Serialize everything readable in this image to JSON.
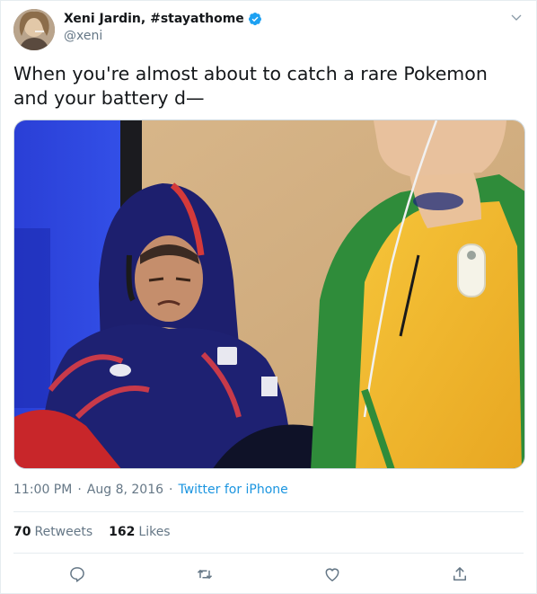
{
  "author": {
    "display_name": "Xeni Jardin, #stayathome",
    "handle": "@xeni",
    "verified": true
  },
  "tweet": {
    "text": "When you're almost about to catch a rare Pokemon\nand your battery d—"
  },
  "meta": {
    "time": "11:00 PM",
    "separator": "·",
    "date": "Aug 8, 2016",
    "source": "Twitter for iPhone"
  },
  "stats": {
    "retweets_count": "70",
    "retweets_label": "Retweets",
    "likes_count": "162",
    "likes_label": "Likes"
  },
  "actions": [
    "reply-icon",
    "retweet-icon",
    "like-icon",
    "share-icon"
  ],
  "colors": {
    "link": "#1b95e0",
    "muted": "#657786",
    "text": "#14171a",
    "verified": "#1da1f2"
  }
}
